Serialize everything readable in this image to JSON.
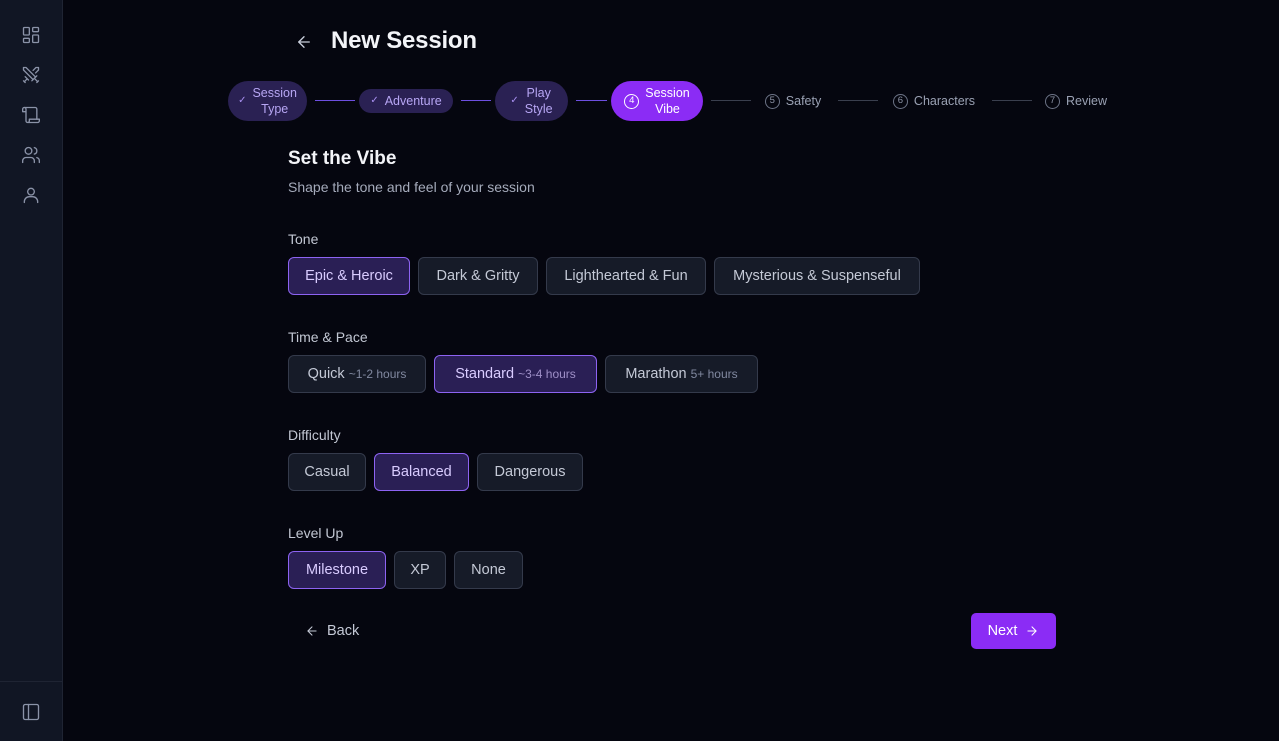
{
  "page": {
    "title": "New Session"
  },
  "sidebar": {
    "items": [
      {
        "name": "dashboard",
        "icon": "grid-icon"
      },
      {
        "name": "adventures",
        "icon": "crossed-swords-icon"
      },
      {
        "name": "scrolls",
        "icon": "scroll-icon"
      },
      {
        "name": "party",
        "icon": "users-icon"
      },
      {
        "name": "profile",
        "icon": "user-icon"
      }
    ],
    "toggle_icon": "sidebar-toggle-icon"
  },
  "stepper": {
    "steps": [
      {
        "line1": "Session",
        "line2": "Type",
        "state": "done",
        "number": "1"
      },
      {
        "line1": "Adventure",
        "line2": "",
        "state": "done",
        "number": "2"
      },
      {
        "line1": "Play",
        "line2": "Style",
        "state": "done",
        "number": "3"
      },
      {
        "line1": "Session",
        "line2": "Vibe",
        "state": "active",
        "number": "4"
      },
      {
        "line1": "Safety",
        "line2": "",
        "state": "future",
        "number": "5"
      },
      {
        "line1": "Characters",
        "line2": "",
        "state": "future",
        "number": "6"
      },
      {
        "line1": "Review",
        "line2": "",
        "state": "future",
        "number": "7"
      }
    ]
  },
  "section": {
    "title": "Set the Vibe",
    "subtitle": "Shape the tone and feel of your session"
  },
  "tone": {
    "label": "Tone",
    "options": [
      "Epic & Heroic",
      "Dark & Gritty",
      "Lighthearted & Fun",
      "Mysterious & Suspenseful"
    ],
    "selected": "Epic & Heroic"
  },
  "pace": {
    "label": "Time & Pace",
    "options": [
      {
        "name": "Quick",
        "hint": "~1-2 hours"
      },
      {
        "name": "Standard",
        "hint": "~3-4 hours"
      },
      {
        "name": "Marathon",
        "hint": "5+ hours"
      }
    ],
    "selected": "Standard"
  },
  "difficulty": {
    "label": "Difficulty",
    "options": [
      "Casual",
      "Balanced",
      "Dangerous"
    ],
    "selected": "Balanced"
  },
  "levelup": {
    "label": "Level Up",
    "options": [
      "Milestone",
      "XP",
      "None"
    ],
    "selected": "Milestone"
  },
  "nav": {
    "back_label": "Back",
    "next_label": "Next"
  },
  "colors": {
    "accent": "#8b2cf5",
    "background": "#05060f",
    "sidebar": "#111624",
    "selected_bg": "#2a1f55"
  }
}
